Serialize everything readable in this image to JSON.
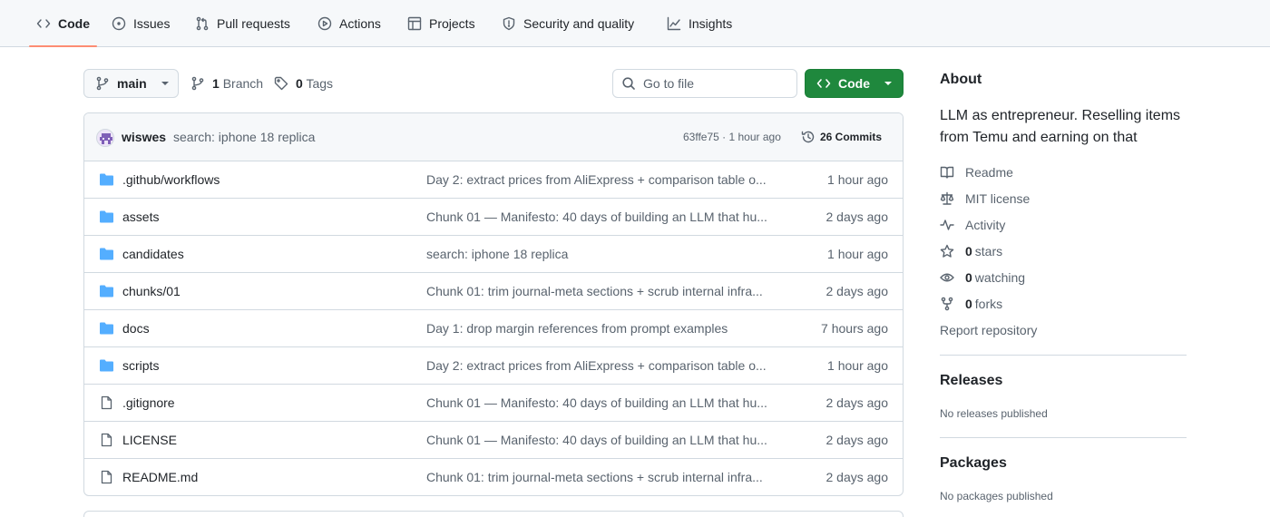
{
  "nav": {
    "tabs": [
      {
        "label": "Code",
        "icon": "code-icon"
      },
      {
        "label": "Issues",
        "icon": "issue-icon"
      },
      {
        "label": "Pull requests",
        "icon": "pull-request-icon"
      },
      {
        "label": "Actions",
        "icon": "play-icon"
      },
      {
        "label": "Projects",
        "icon": "table-icon"
      },
      {
        "label": "Security and quality",
        "icon": "shield-icon"
      },
      {
        "label": "Insights",
        "icon": "graph-icon"
      }
    ],
    "active_tab": "Code",
    "active_color": "#fd8c73"
  },
  "toolbar": {
    "branch": "main",
    "branch_count": "1",
    "branch_label": "Branch",
    "tag_count": "0",
    "tag_label": "Tags",
    "search_placeholder": "Go to file",
    "code_button": "Code",
    "code_button_color": "#1f883d"
  },
  "latest_commit": {
    "author": "wiswes",
    "message": "search: iphone 18 replica",
    "hash_time": "63ffe75 · 1 hour ago",
    "commits_label": "26 Commits"
  },
  "files": [
    {
      "name": ".github/workflows",
      "type": "folder",
      "message": "Day 2: extract prices from AliExpress + comparison table o...",
      "time": "1 hour ago"
    },
    {
      "name": "assets",
      "type": "folder",
      "message": "Chunk 01 — Manifesto: 40 days of building an LLM that hu...",
      "time": "2 days ago"
    },
    {
      "name": "candidates",
      "type": "folder",
      "message": "search: iphone 18 replica",
      "time": "1 hour ago"
    },
    {
      "name": "chunks/01",
      "type": "folder",
      "message": "Chunk 01: trim journal-meta sections + scrub internal infra...",
      "time": "2 days ago"
    },
    {
      "name": "docs",
      "type": "folder",
      "message": "Day 1: drop margin references from prompt examples",
      "time": "7 hours ago"
    },
    {
      "name": "scripts",
      "type": "folder",
      "message": "Day 2: extract prices from AliExpress + comparison table o...",
      "time": "1 hour ago"
    },
    {
      "name": ".gitignore",
      "type": "file",
      "message": "Chunk 01 — Manifesto: 40 days of building an LLM that hu...",
      "time": "2 days ago"
    },
    {
      "name": "LICENSE",
      "type": "file",
      "message": "Chunk 01 — Manifesto: 40 days of building an LLM that hu...",
      "time": "2 days ago"
    },
    {
      "name": "README.md",
      "type": "file",
      "message": "Chunk 01: trim journal-meta sections + scrub internal infra...",
      "time": "2 days ago"
    }
  ],
  "about": {
    "heading": "About",
    "description": "LLM as entrepreneur. Reselling items from Temu and earning on that",
    "readme": "Readme",
    "license": "MIT license",
    "activity": "Activity",
    "stars_count": "0",
    "stars_label": "stars",
    "watching_count": "0",
    "watching_label": "watching",
    "forks_count": "0",
    "forks_label": "forks",
    "report": "Report repository"
  },
  "releases": {
    "heading": "Releases",
    "empty": "No releases published"
  },
  "packages": {
    "heading": "Packages",
    "empty": "No packages published"
  },
  "colors": {
    "folder": "#54aeff",
    "border": "#d1d9e0",
    "muted_text": "#59636e"
  }
}
